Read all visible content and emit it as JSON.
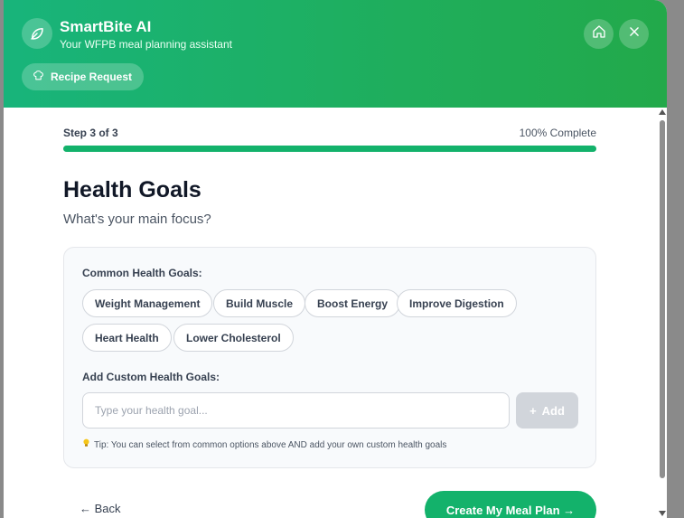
{
  "header": {
    "title": "SmartBite AI",
    "subtitle": "Your WFPB meal planning assistant",
    "chip_label": "Recipe Request",
    "logo_icon": "leaf-icon",
    "home_icon": "home-icon",
    "close_icon": "close-icon"
  },
  "progress": {
    "step_label": "Step 3 of 3",
    "percent_label": "100% Complete",
    "value": 1.0
  },
  "main": {
    "heading": "Health Goals",
    "subheading": "What's your main focus?"
  },
  "panel": {
    "common_label": "Common Health Goals:",
    "goals": [
      "Weight Management",
      "Build Muscle",
      "Boost Energy",
      "Improve Digestion",
      "Heart Health",
      "Lower Cholesterol"
    ],
    "custom_label": "Add Custom Health Goals:",
    "input_placeholder": "Type your health goal...",
    "input_value": "",
    "add_label": "Add",
    "tip": "Tip: You can select from common options above AND add your own custom health goals"
  },
  "footer": {
    "back_label": "← Back",
    "submit_label": "Create My Meal Plan →"
  },
  "colors": {
    "accent": "#13b26b",
    "header_start": "#18b47b",
    "header_end": "#22a94a"
  }
}
